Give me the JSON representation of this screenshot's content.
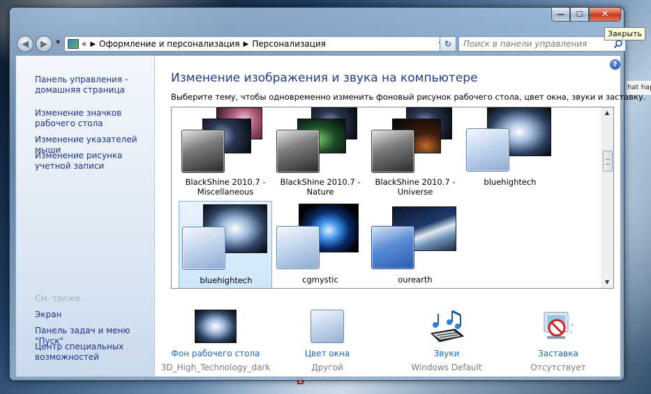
{
  "desktop": {
    "snippet": "hat happ",
    "watermark_prefix": "B",
    "watermark_rest": "otvet.ru"
  },
  "window": {
    "captions": {
      "minimize_glyph": "—",
      "maximize_glyph": "☐",
      "close_glyph": "✕"
    },
    "tooltip": "Закрыть"
  },
  "nav": {
    "back_glyph": "◀",
    "forward_glyph": "▶",
    "history_glyph": "▼",
    "address": {
      "prefix": "«",
      "crumbs": [
        "Оформление и персонализация",
        "Персонализация"
      ],
      "separator": "▶",
      "dropdown_glyph": "▼"
    },
    "refresh_glyph": "↻",
    "search_placeholder": "Поиск в панели управления"
  },
  "sidebar": {
    "links": [
      "Панель управления - домашняя страница",
      "Изменение значков рабочего стола",
      "Изменение указателей мыши",
      "Изменение рисунка учетной записи"
    ],
    "see_also_heading": "См. также",
    "see_also": [
      "Экран",
      "Панель задач и меню \"Пуск\"",
      "Центр специальных возможностей"
    ]
  },
  "main": {
    "help_glyph": "?",
    "title": "Изменение изображения и звука на компьютере",
    "description": "Выберите тему, чтобы одновременно изменить фоновый рисунок рабочего стола, цвет окна, звуки и заставку.",
    "themes": [
      {
        "line1": "BlackShine 2010.7 -",
        "line2": "Miscellaneous",
        "selected": false
      },
      {
        "line1": "BlackShine 2010.7 -",
        "line2": "Nature",
        "selected": false
      },
      {
        "line1": "BlackShine 2010.7 -",
        "line2": "Universe",
        "selected": false
      },
      {
        "line1": "bluehightech",
        "line2": "",
        "selected": false
      },
      {
        "line1": "bluehightech",
        "line2": "",
        "selected": true
      },
      {
        "line1": "cgmystic",
        "line2": "",
        "selected": false
      },
      {
        "line1": "ourearth",
        "line2": "",
        "selected": false
      }
    ],
    "scrollbar": {
      "up_glyph": "▲",
      "down_glyph": "▼"
    }
  },
  "settings": [
    {
      "label": "Фон рабочего стола",
      "value": "3D_High_Technology_dark",
      "icon": "wallpaper-icon"
    },
    {
      "label": "Цвет окна",
      "value": "Другой",
      "icon": "window-color-icon"
    },
    {
      "label": "Звуки",
      "value": "Windows Default",
      "icon": "sounds-icon"
    },
    {
      "label": "Заставка",
      "value": "Отсутствует",
      "icon": "screensaver-icon"
    }
  ],
  "colors": {
    "link": "#1e3287",
    "setting_link": "#1f66b8",
    "title": "#1e3a8a",
    "close_button": "#c43218"
  }
}
